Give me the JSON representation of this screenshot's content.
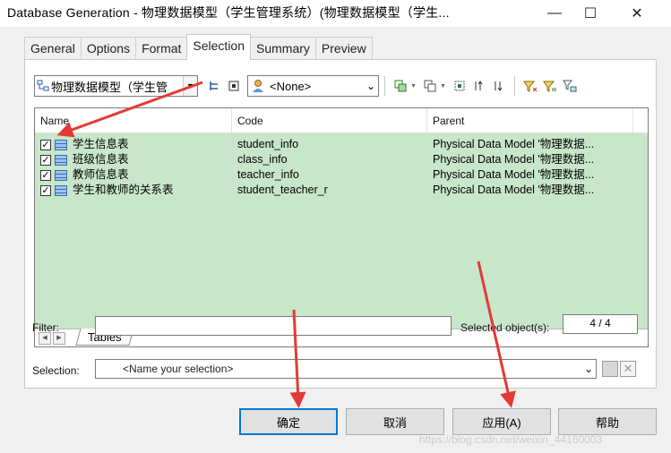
{
  "window": {
    "title": "Database Generation - 物理数据模型（学生管理系统）(物理数据模型（学生...",
    "minimize_glyph": "—",
    "maximize_glyph": "☐",
    "close_glyph": "✕"
  },
  "tabs": [
    "General",
    "Options",
    "Format",
    "Selection",
    "Summary",
    "Preview"
  ],
  "active_tab": "Selection",
  "toolbar": {
    "model_combo": "物理数据模型（学生管",
    "owner_combo": "<None>"
  },
  "grid": {
    "columns": [
      "Name",
      "Code",
      "Parent"
    ],
    "rows": [
      {
        "checked": true,
        "name": "学生信息表",
        "code": "student_info",
        "parent": "Physical Data Model '物理数据..."
      },
      {
        "checked": true,
        "name": "班级信息表",
        "code": "class_info",
        "parent": "Physical Data Model '物理数据..."
      },
      {
        "checked": true,
        "name": "教师信息表",
        "code": "teacher_info",
        "parent": "Physical Data Model '物理数据..."
      },
      {
        "checked": true,
        "name": "学生和教师的关系表",
        "code": "student_teacher_r",
        "parent": "Physical Data Model '物理数据..."
      }
    ],
    "sheet_tab": "Tables"
  },
  "filter": {
    "label": "Filter:",
    "value": ""
  },
  "selected_objects": {
    "label": "Selected object(s):",
    "value": "4 / 4"
  },
  "selection": {
    "label": "Selection:",
    "placeholder": "<Name your selection>"
  },
  "buttons": {
    "ok": "确定",
    "cancel": "取消",
    "apply": "应用(A)",
    "help": "帮助"
  },
  "watermark": "https://blog.csdn.net/weixin_44160003",
  "colors": {
    "grid_bg": "#c8e6c9",
    "annotation_arrow": "#e53935",
    "default_button_border": "#0078d7"
  }
}
